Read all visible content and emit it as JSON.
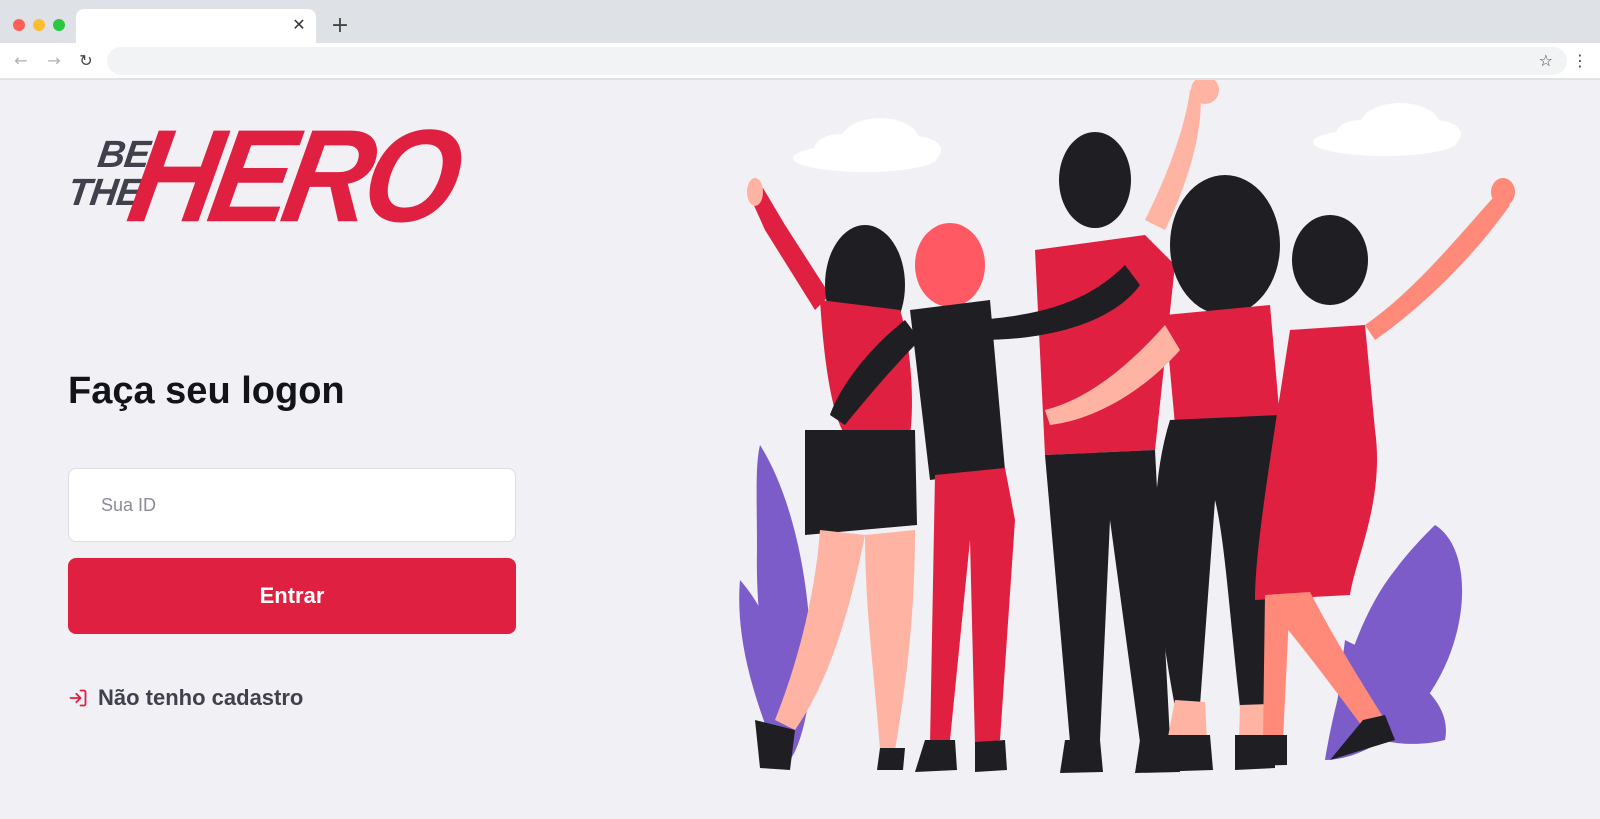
{
  "browser": {
    "tab_title": "",
    "tab_close_icon": "close-icon",
    "new_tab_icon": "plus-icon",
    "address": "",
    "back_icon": "arrow-left-icon",
    "forward_icon": "arrow-right-icon",
    "reload_icon": "reload-icon",
    "bookmark_icon": "star-icon",
    "menu_icon": "kebab-menu-icon"
  },
  "logo": {
    "line1": "BE",
    "line2": "THE",
    "line3": "HERO"
  },
  "login": {
    "heading": "Faça seu logon",
    "id_placeholder": "Sua ID",
    "id_value": "",
    "submit_label": "Entrar",
    "register_label": "Não tenho cadastro",
    "register_icon": "log-in-arrow-icon"
  },
  "colors": {
    "brand_red": "#e02041",
    "page_bg": "#f0f0f5",
    "text_dark": "#13131a",
    "text_muted": "#41414d",
    "plant_purple": "#7c5cc8"
  }
}
